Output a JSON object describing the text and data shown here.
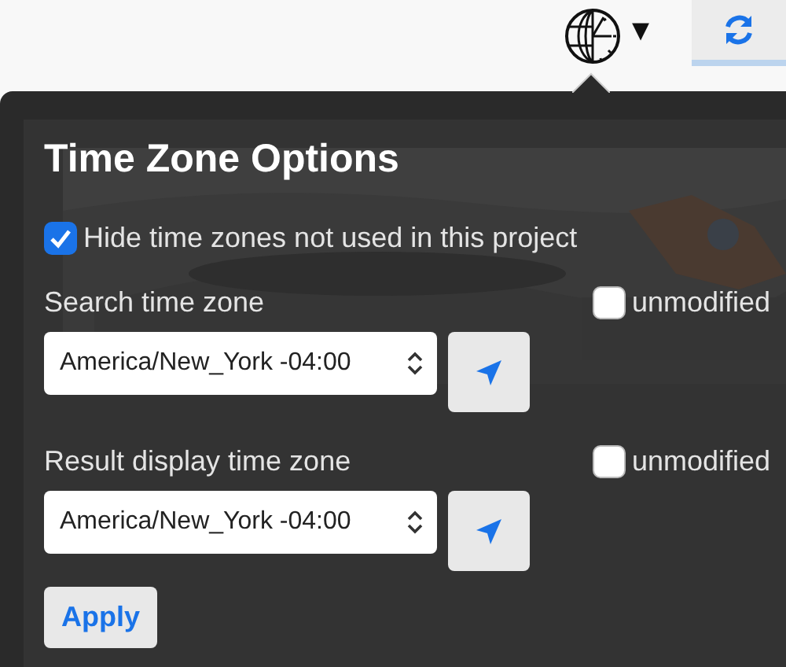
{
  "toolbar": {
    "timezone_menu_caret": "▾"
  },
  "popover": {
    "title": "Time Zone Options",
    "hide_unused": {
      "label": "Hide time zones not used in this project",
      "checked": true
    },
    "fields": [
      {
        "label": "Search time zone",
        "value": "America/New_York -04:00",
        "unmodified": {
          "label": "unmodified",
          "checked": false
        }
      },
      {
        "label": "Result display time zone",
        "value": "America/New_York -04:00",
        "unmodified": {
          "label": "unmodified",
          "checked": false
        }
      }
    ],
    "apply_button": "Apply"
  }
}
